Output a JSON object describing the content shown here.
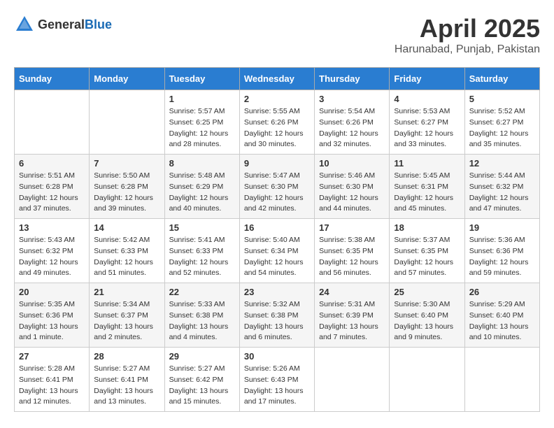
{
  "header": {
    "logo_general": "General",
    "logo_blue": "Blue",
    "month": "April 2025",
    "location": "Harunabad, Punjab, Pakistan"
  },
  "days_of_week": [
    "Sunday",
    "Monday",
    "Tuesday",
    "Wednesday",
    "Thursday",
    "Friday",
    "Saturday"
  ],
  "weeks": [
    [
      {
        "day": "",
        "sunrise": "",
        "sunset": "",
        "daylight": ""
      },
      {
        "day": "",
        "sunrise": "",
        "sunset": "",
        "daylight": ""
      },
      {
        "day": "1",
        "sunrise": "Sunrise: 5:57 AM",
        "sunset": "Sunset: 6:25 PM",
        "daylight": "Daylight: 12 hours and 28 minutes."
      },
      {
        "day": "2",
        "sunrise": "Sunrise: 5:55 AM",
        "sunset": "Sunset: 6:26 PM",
        "daylight": "Daylight: 12 hours and 30 minutes."
      },
      {
        "day": "3",
        "sunrise": "Sunrise: 5:54 AM",
        "sunset": "Sunset: 6:26 PM",
        "daylight": "Daylight: 12 hours and 32 minutes."
      },
      {
        "day": "4",
        "sunrise": "Sunrise: 5:53 AM",
        "sunset": "Sunset: 6:27 PM",
        "daylight": "Daylight: 12 hours and 33 minutes."
      },
      {
        "day": "5",
        "sunrise": "Sunrise: 5:52 AM",
        "sunset": "Sunset: 6:27 PM",
        "daylight": "Daylight: 12 hours and 35 minutes."
      }
    ],
    [
      {
        "day": "6",
        "sunrise": "Sunrise: 5:51 AM",
        "sunset": "Sunset: 6:28 PM",
        "daylight": "Daylight: 12 hours and 37 minutes."
      },
      {
        "day": "7",
        "sunrise": "Sunrise: 5:50 AM",
        "sunset": "Sunset: 6:28 PM",
        "daylight": "Daylight: 12 hours and 39 minutes."
      },
      {
        "day": "8",
        "sunrise": "Sunrise: 5:48 AM",
        "sunset": "Sunset: 6:29 PM",
        "daylight": "Daylight: 12 hours and 40 minutes."
      },
      {
        "day": "9",
        "sunrise": "Sunrise: 5:47 AM",
        "sunset": "Sunset: 6:30 PM",
        "daylight": "Daylight: 12 hours and 42 minutes."
      },
      {
        "day": "10",
        "sunrise": "Sunrise: 5:46 AM",
        "sunset": "Sunset: 6:30 PM",
        "daylight": "Daylight: 12 hours and 44 minutes."
      },
      {
        "day": "11",
        "sunrise": "Sunrise: 5:45 AM",
        "sunset": "Sunset: 6:31 PM",
        "daylight": "Daylight: 12 hours and 45 minutes."
      },
      {
        "day": "12",
        "sunrise": "Sunrise: 5:44 AM",
        "sunset": "Sunset: 6:32 PM",
        "daylight": "Daylight: 12 hours and 47 minutes."
      }
    ],
    [
      {
        "day": "13",
        "sunrise": "Sunrise: 5:43 AM",
        "sunset": "Sunset: 6:32 PM",
        "daylight": "Daylight: 12 hours and 49 minutes."
      },
      {
        "day": "14",
        "sunrise": "Sunrise: 5:42 AM",
        "sunset": "Sunset: 6:33 PM",
        "daylight": "Daylight: 12 hours and 51 minutes."
      },
      {
        "day": "15",
        "sunrise": "Sunrise: 5:41 AM",
        "sunset": "Sunset: 6:33 PM",
        "daylight": "Daylight: 12 hours and 52 minutes."
      },
      {
        "day": "16",
        "sunrise": "Sunrise: 5:40 AM",
        "sunset": "Sunset: 6:34 PM",
        "daylight": "Daylight: 12 hours and 54 minutes."
      },
      {
        "day": "17",
        "sunrise": "Sunrise: 5:38 AM",
        "sunset": "Sunset: 6:35 PM",
        "daylight": "Daylight: 12 hours and 56 minutes."
      },
      {
        "day": "18",
        "sunrise": "Sunrise: 5:37 AM",
        "sunset": "Sunset: 6:35 PM",
        "daylight": "Daylight: 12 hours and 57 minutes."
      },
      {
        "day": "19",
        "sunrise": "Sunrise: 5:36 AM",
        "sunset": "Sunset: 6:36 PM",
        "daylight": "Daylight: 12 hours and 59 minutes."
      }
    ],
    [
      {
        "day": "20",
        "sunrise": "Sunrise: 5:35 AM",
        "sunset": "Sunset: 6:36 PM",
        "daylight": "Daylight: 13 hours and 1 minute."
      },
      {
        "day": "21",
        "sunrise": "Sunrise: 5:34 AM",
        "sunset": "Sunset: 6:37 PM",
        "daylight": "Daylight: 13 hours and 2 minutes."
      },
      {
        "day": "22",
        "sunrise": "Sunrise: 5:33 AM",
        "sunset": "Sunset: 6:38 PM",
        "daylight": "Daylight: 13 hours and 4 minutes."
      },
      {
        "day": "23",
        "sunrise": "Sunrise: 5:32 AM",
        "sunset": "Sunset: 6:38 PM",
        "daylight": "Daylight: 13 hours and 6 minutes."
      },
      {
        "day": "24",
        "sunrise": "Sunrise: 5:31 AM",
        "sunset": "Sunset: 6:39 PM",
        "daylight": "Daylight: 13 hours and 7 minutes."
      },
      {
        "day": "25",
        "sunrise": "Sunrise: 5:30 AM",
        "sunset": "Sunset: 6:40 PM",
        "daylight": "Daylight: 13 hours and 9 minutes."
      },
      {
        "day": "26",
        "sunrise": "Sunrise: 5:29 AM",
        "sunset": "Sunset: 6:40 PM",
        "daylight": "Daylight: 13 hours and 10 minutes."
      }
    ],
    [
      {
        "day": "27",
        "sunrise": "Sunrise: 5:28 AM",
        "sunset": "Sunset: 6:41 PM",
        "daylight": "Daylight: 13 hours and 12 minutes."
      },
      {
        "day": "28",
        "sunrise": "Sunrise: 5:27 AM",
        "sunset": "Sunset: 6:41 PM",
        "daylight": "Daylight: 13 hours and 13 minutes."
      },
      {
        "day": "29",
        "sunrise": "Sunrise: 5:27 AM",
        "sunset": "Sunset: 6:42 PM",
        "daylight": "Daylight: 13 hours and 15 minutes."
      },
      {
        "day": "30",
        "sunrise": "Sunrise: 5:26 AM",
        "sunset": "Sunset: 6:43 PM",
        "daylight": "Daylight: 13 hours and 17 minutes."
      },
      {
        "day": "",
        "sunrise": "",
        "sunset": "",
        "daylight": ""
      },
      {
        "day": "",
        "sunrise": "",
        "sunset": "",
        "daylight": ""
      },
      {
        "day": "",
        "sunrise": "",
        "sunset": "",
        "daylight": ""
      }
    ]
  ]
}
